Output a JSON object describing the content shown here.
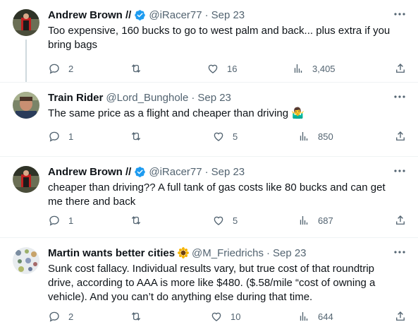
{
  "tweets": [
    {
      "name": "Andrew Brown //",
      "handle": "@iRacer77",
      "time": "Sep 23",
      "verified": true,
      "text": "Too expensive, 160 bucks to go to west palm and back... plus extra if you bring bags",
      "replies": "2",
      "retweets": "",
      "likes": "16",
      "views": "3,405"
    },
    {
      "name": "Train Rider",
      "handle": "@Lord_Bunghole",
      "time": "Sep 23",
      "verified": false,
      "text": "The same price as a flight and cheaper than driving 🤷‍♂️",
      "replies": "1",
      "retweets": "",
      "likes": "5",
      "views": "850"
    },
    {
      "name": "Andrew Brown //",
      "handle": "@iRacer77",
      "time": "Sep 23",
      "verified": true,
      "text": "cheaper than driving?? A full tank of gas costs like 80 bucks and can get me there and back",
      "replies": "1",
      "retweets": "",
      "likes": "5",
      "views": "687"
    },
    {
      "name": "Martin wants better cities",
      "name_emoji": "🌻",
      "handle": "@M_Friedrichs",
      "time": "Sep 23",
      "verified": false,
      "text": "Sunk cost fallacy. Individual results vary, but true cost of that roundtrip drive, according to AAA is more like $480. ($.58/mile “cost of owning a vehicle). And you can’t do anything else during that time.",
      "replies": "2",
      "retweets": "",
      "likes": "10",
      "views": "644"
    }
  ],
  "colors": {
    "text": "#0f1419",
    "muted": "#536471",
    "verified": "#1d9bf0",
    "divider": "#eff3f4"
  },
  "separator": "·"
}
